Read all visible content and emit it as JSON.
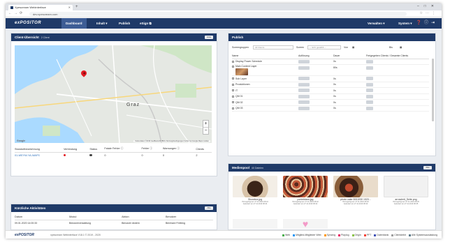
{
  "browser": {
    "tab_title": "Xpescream Webinterface",
    "url": "dev.xpescream.com"
  },
  "nav": {
    "logo": "exPOSITOR",
    "dashboard": "Dashboard",
    "inhalt": "Inhalt ▾",
    "publish": "Publish",
    "edge": "eSign ⧉",
    "verwalten": "Verwalten ▾",
    "system": "System ▾"
  },
  "clients": {
    "title": "Client-Übersicht",
    "subtitle": "2 Client",
    "btn": "Liste",
    "city": "Graz",
    "google": "Google",
    "attribution": "Kartendaten ©2019 GeoBasis-DE/BKG  Nutzungsbedingungen  Fehler bei Google Maps melden",
    "columns": [
      "Standortbezeichnung",
      "Verbindung",
      "Status",
      "Fatale Fehler ⓘ",
      "Fehler ⓘ",
      "Warnungen ⓘ",
      "Clients"
    ],
    "row": {
      "name": "01-WEYW-YA-WAFS",
      "fatal": "0",
      "errors": "0",
      "warnings": "0",
      "clients": "2"
    },
    "status_colors": {
      "connection": "#e31b23",
      "status": "#444444"
    }
  },
  "activities": {
    "title": "Kürzliche Aktivitäten",
    "btn": "Alle",
    "columns": [
      "Datum",
      "Modul",
      "Aktion",
      "Benutzer"
    ],
    "row": {
      "date": "09.01.2020 14:00:33",
      "module": "Benutzerverwaltung",
      "action": "Benutzer ändern",
      "user": "Bernhard Freibing"
    }
  },
  "publish": {
    "title": "Publish",
    "filter": {
      "group_label": "Screengruppen",
      "group_value": "All Clients",
      "screen_label": "Screen",
      "screen_value": "-- nicht gewählt --",
      "from_label": "Von",
      "to_label": "Bis"
    },
    "columns": [
      "Name",
      "Auflösung",
      "Dauer",
      "Freigegeben Clients / Gesamte Clients"
    ],
    "rows": [
      {
        "name": "Display Power Schedule",
        "dur": "0s"
      },
      {
        "name": "Main Content Layer",
        "dur": "80s"
      },
      {
        "name": "Sub Layer",
        "dur": "0s"
      },
      {
        "name": "Produktionen",
        "dur": "0s"
      },
      {
        "name": "IT",
        "dur": "0s"
      },
      {
        "name": "QM 01",
        "dur": "0s"
      },
      {
        "name": "QM 02",
        "dur": "0s"
      },
      {
        "name": "QM 03",
        "dur": "0s"
      }
    ]
  },
  "media": {
    "title": "Medienpool",
    "subtitle": "40 Dateien",
    "btn": "Alle",
    "items": [
      {
        "name": "Showbox.jpg",
        "info1": "Hinzugefügt am 27.11.2019 08:44",
        "info2": "Geändert am 27.11.2019 08:44",
        "color": "#8a5a3c"
      },
      {
        "name": "portofolans.jpg",
        "info1": "Hinzugefügt am 27.11.2019 08:42",
        "info2": "Geändert am 27.11.2019 08:42",
        "color": "#7e3a2e"
      },
      {
        "name": "photo cake 3001930 1920...",
        "info1": "Hinzugefügt am 27.11.2019 08:40",
        "info2": "Geändert am 27.11.2019 08:40",
        "color": "#5a3325"
      },
      {
        "name": "arrowlerit_Seite.png",
        "info1": "Hinzugefügt am 27.11.2019 08:35",
        "info2": "Geändert am 27.11.2019 08:35",
        "color": "#f1f1f1"
      }
    ]
  },
  "footer": {
    "logo": "exPOSITOR",
    "version": "xpescream Webinterface V18.1 © 2019 - 2020",
    "legend": [
      "Web",
      "Mitglied-Mitglieder Web",
      "Syncing",
      "Playlog",
      "Origin",
      "PFT",
      "Datenbank",
      "Clientdebit",
      "Alle Systemsauslastung"
    ],
    "legend_colors": [
      "#4caf50",
      "#2196f3",
      "#ff9800",
      "#e91e63",
      "#8bc34a",
      "#f44336",
      "#3f51b5",
      "#9e9e9e",
      "#607d8b"
    ]
  }
}
